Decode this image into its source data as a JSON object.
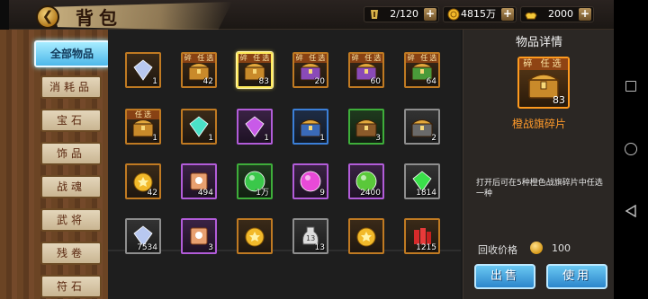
{
  "header": {
    "back_icon": "back-arrow-icon",
    "title": "背包"
  },
  "resources": [
    {
      "icon": "bag-capacity-icon",
      "value": "2/120",
      "color": "#d7b24a"
    },
    {
      "icon": "gold-coin-icon",
      "value": "4815万",
      "color": "#f2b92a"
    },
    {
      "icon": "gold-ingot-icon",
      "value": "2000",
      "color": "#f5c93a"
    }
  ],
  "categories": [
    {
      "label": "全部物品",
      "active": true
    },
    {
      "label": "消耗品",
      "active": false
    },
    {
      "label": "宝石",
      "active": false
    },
    {
      "label": "饰品",
      "active": false
    },
    {
      "label": "战魂",
      "active": false
    },
    {
      "label": "武将",
      "active": false
    },
    {
      "label": "残卷",
      "active": false
    },
    {
      "label": "符石",
      "active": false
    }
  ],
  "items": [
    {
      "icon": "random-crystal-icon",
      "count": "1",
      "rarity": "orange",
      "frag": ""
    },
    {
      "icon": "orange-chest-fragment-icon",
      "count": "42",
      "rarity": "orange",
      "frag": "碎 任选"
    },
    {
      "icon": "orange-chest-fragment-icon",
      "count": "83",
      "rarity": "orange",
      "frag": "碎 任选",
      "selected": true
    },
    {
      "icon": "purple-chest-fragment-icon",
      "count": "20",
      "rarity": "orange",
      "frag": "碎 任选"
    },
    {
      "icon": "purple-chest-fragment-icon",
      "count": "60",
      "rarity": "orange",
      "frag": "碎 任选"
    },
    {
      "icon": "green-chest-fragment-icon",
      "count": "64",
      "rarity": "orange",
      "frag": "碎 任选"
    },
    {
      "icon": "orange-chest-icon",
      "count": "1",
      "rarity": "orange",
      "frag": "任选"
    },
    {
      "icon": "random-gem-icon",
      "count": "1",
      "rarity": "orange",
      "frag": ""
    },
    {
      "icon": "random-gem-purple-icon",
      "count": "1",
      "rarity": "purple",
      "frag": ""
    },
    {
      "icon": "lightning-chest-icon",
      "count": "1",
      "rarity": "blue",
      "frag": ""
    },
    {
      "icon": "wooden-chest-icon",
      "count": "3",
      "rarity": "green",
      "frag": ""
    },
    {
      "icon": "iron-chest-icon",
      "count": "2",
      "rarity": "gray",
      "frag": ""
    },
    {
      "icon": "medal-scroll-icon",
      "count": "42",
      "rarity": "orange",
      "frag": ""
    },
    {
      "icon": "outfit-token-icon",
      "count": "494",
      "rarity": "purple",
      "frag": ""
    },
    {
      "icon": "green-orb-icon",
      "count": "1万",
      "rarity": "green",
      "frag": ""
    },
    {
      "icon": "pink-energy-orb-icon",
      "count": "9",
      "rarity": "purple",
      "frag": ""
    },
    {
      "icon": "paw-orb-icon",
      "count": "2400",
      "rarity": "purple",
      "frag": ""
    },
    {
      "icon": "green-gem-icon",
      "count": "1814",
      "rarity": "gray",
      "frag": ""
    },
    {
      "icon": "crystal-shard-icon",
      "count": "7534",
      "rarity": "gray",
      "frag": ""
    },
    {
      "icon": "scroll-icon",
      "count": "3",
      "rarity": "purple",
      "frag": ""
    },
    {
      "icon": "gold-medal-icon",
      "count": "",
      "rarity": "orange",
      "frag": ""
    },
    {
      "icon": "potion-jar-icon",
      "count": "13",
      "rarity": "gray",
      "frag": ""
    },
    {
      "icon": "gold-star-coin-icon",
      "count": "",
      "rarity": "orange",
      "frag": ""
    },
    {
      "icon": "firecracker-icon",
      "count": "1215",
      "rarity": "orange",
      "frag": ""
    }
  ],
  "detail": {
    "title": "物品详情",
    "item_icon": "orange-chest-fragment-icon",
    "frag_label": "碎 任选",
    "count": "83",
    "name": "橙战旗碎片",
    "name_color": "#ff9a2a",
    "description": "打开后可在5种橙色战旗碎片中任选一种",
    "price_label": "回收价格",
    "price_icon": "gold-coin-icon",
    "price_value": "100",
    "sell_label": "出售",
    "use_label": "使用"
  },
  "system_nav": [
    "recent-apps-icon",
    "home-icon",
    "back-triangle-icon"
  ]
}
